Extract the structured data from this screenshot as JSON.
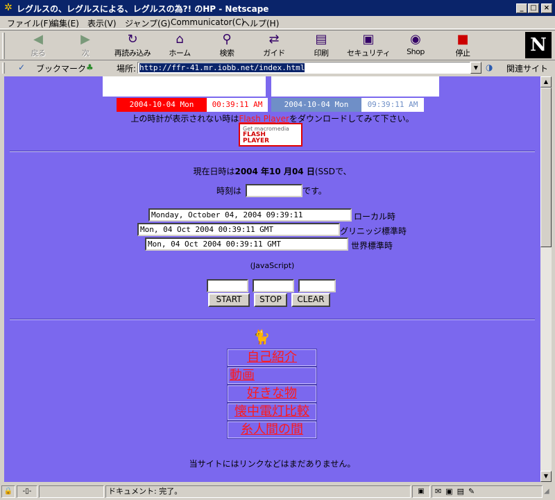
{
  "window": {
    "title": "レグルスの、レグルスによる、レグルスの為?! のHP - Netscape",
    "minimize": "_",
    "maximize": "□",
    "close": "×"
  },
  "menu": [
    "ファイル(F)",
    "編集(E)",
    "表示(V)",
    "ジャンプ(G)",
    "Communicator(C)",
    "ヘルプ(H)"
  ],
  "toolbar": {
    "buttons": [
      {
        "label": "戻る",
        "icon": "back-arrow-icon",
        "enabled": false
      },
      {
        "label": "次",
        "icon": "forward-arrow-icon",
        "enabled": false
      },
      {
        "label": "再読み込み",
        "icon": "reload-icon",
        "enabled": true
      },
      {
        "label": "ホーム",
        "icon": "home-icon",
        "enabled": true
      },
      {
        "label": "検索",
        "icon": "search-icon",
        "enabled": true
      },
      {
        "label": "ガイド",
        "icon": "guide-icon",
        "enabled": true
      },
      {
        "label": "印刷",
        "icon": "print-icon",
        "enabled": true
      },
      {
        "label": "セキュリティ",
        "icon": "lock-icon",
        "enabled": true
      },
      {
        "label": "Shop",
        "icon": "shop-icon",
        "enabled": true
      },
      {
        "label": "停止",
        "icon": "stop-icon",
        "enabled": true
      }
    ],
    "logo": "N"
  },
  "location": {
    "bookmarks_label": "ブックマーク",
    "location_label": "場所:",
    "url": "http://ffr-41.mr.iobb.net/index.html",
    "related_label": "関連サイト"
  },
  "page": {
    "clock_left": {
      "date": "2004-10-04  Mon",
      "time": "00:39:11  AM"
    },
    "clock_right": {
      "date": "2004-10-04  Mon",
      "time": "09:39:11  AM"
    },
    "flash_note_before": "上の時計が表示されない時は",
    "flash_link": "Flash Player",
    "flash_note_after": "をダウンロードしてみて下さい。",
    "flash_badge": {
      "line1": "Get macromedia",
      "line2": "FLASH",
      "line3": "PLAYER"
    },
    "date_line": {
      "prefix": "現在日時は",
      "date": "2004 年10 月04 日",
      "suffix": "(SSDで、"
    },
    "time_line": {
      "prefix": "時刻は",
      "value": "",
      "suffix": "です。"
    },
    "time_fields": [
      {
        "value": "Monday, October 04, 2004 09:39:11",
        "label": "ローカル時"
      },
      {
        "value": "Mon, 04 Oct 2004 00:39:11 GMT",
        "label": "グリニッジ標準時"
      },
      {
        "value": "Mon, 04 Oct 2004 00:39:11 GMT",
        "label": "世界標準時"
      }
    ],
    "script_note": "(JavaScript)",
    "stopwatch": {
      "fields": [
        "",
        "",
        ""
      ],
      "start": "START",
      "stop": "STOP",
      "clear": "CLEAR"
    },
    "nav_links": [
      "自己紹介",
      "動画",
      "好きな物",
      "懐中電灯比較",
      "糸人間の間"
    ],
    "footer_note": "当サイトにはリンクなどはまだありません。"
  },
  "status": {
    "text": "ドキュメント: 完了。"
  },
  "colors": {
    "page_bg": "#7b68ee",
    "link": "#ff1a1a",
    "clock_left_bg": "#ff0000",
    "clock_right_bg": "#6f8fc7",
    "titlebar": "#0a246a"
  }
}
